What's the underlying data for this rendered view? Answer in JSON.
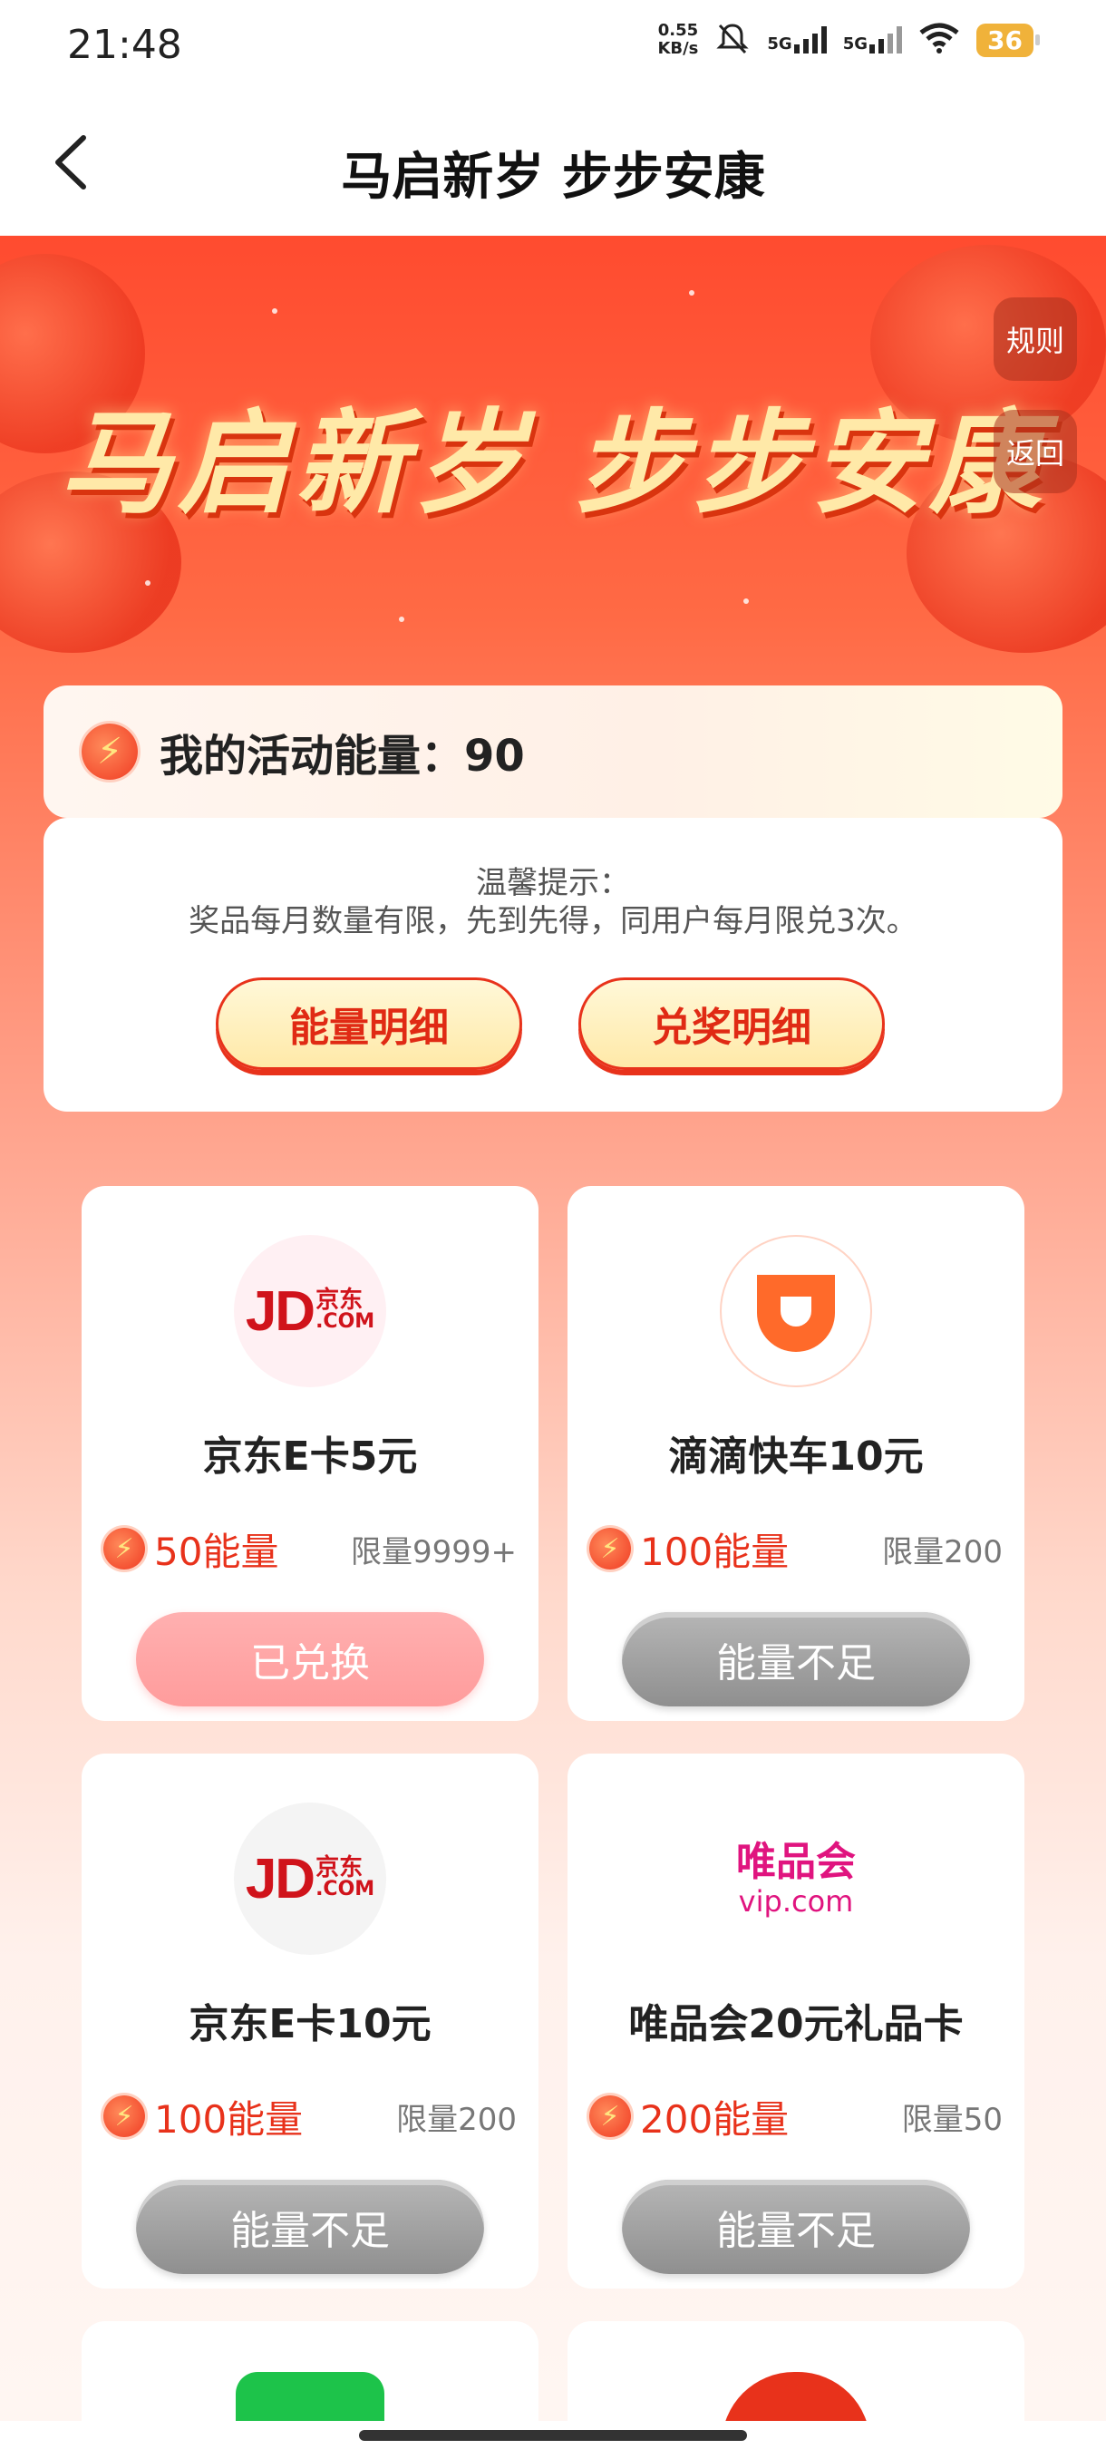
{
  "status_bar": {
    "time": "21:48",
    "net_speed_value": "0.55",
    "net_speed_unit": "KB/s",
    "sim1": "5G",
    "sim2": "5G",
    "battery": "36"
  },
  "nav": {
    "title": "马启新岁 步步安康"
  },
  "banner": {
    "title": "马启新岁 步步安康",
    "rules_label": "规则",
    "return_label": "返回"
  },
  "energy": {
    "label": "我的活动能量：90"
  },
  "tips": {
    "title": "温馨提示：",
    "text": "奖品每月数量有限，先到先得，同用户每月限兑3次。",
    "energy_detail_label": "能量明细",
    "prize_detail_label": "兑奖明细"
  },
  "prizes": [
    {
      "name": "京东E卡5元",
      "cost": "50能量",
      "limit": "限量9999+",
      "button": "已兑换",
      "logo": "jd-logo"
    },
    {
      "name": "滴滴快车10元",
      "cost": "100能量",
      "limit": "限量200",
      "button": "能量不足",
      "logo": "didi-logo"
    },
    {
      "name": "京东E卡10元",
      "cost": "100能量",
      "limit": "限量200",
      "button": "能量不足",
      "logo": "jd-logo"
    },
    {
      "name": "唯品会20元礼品卡",
      "cost": "200能量",
      "limit": "限量50",
      "button": "能量不足",
      "logo": "vip-logo"
    }
  ],
  "logos": {
    "jd_main": "JD",
    "jd_cn": "京东",
    "jd_com": ".COM",
    "vip_cn": "唯品会",
    "vip_en": "vip.com"
  },
  "colors": {
    "accent_red": "#e8321b",
    "banner_gold": "#ffe9a8",
    "disabled_grey": "#9a9a9a",
    "redeemed_pink": "#ff9c9c"
  }
}
